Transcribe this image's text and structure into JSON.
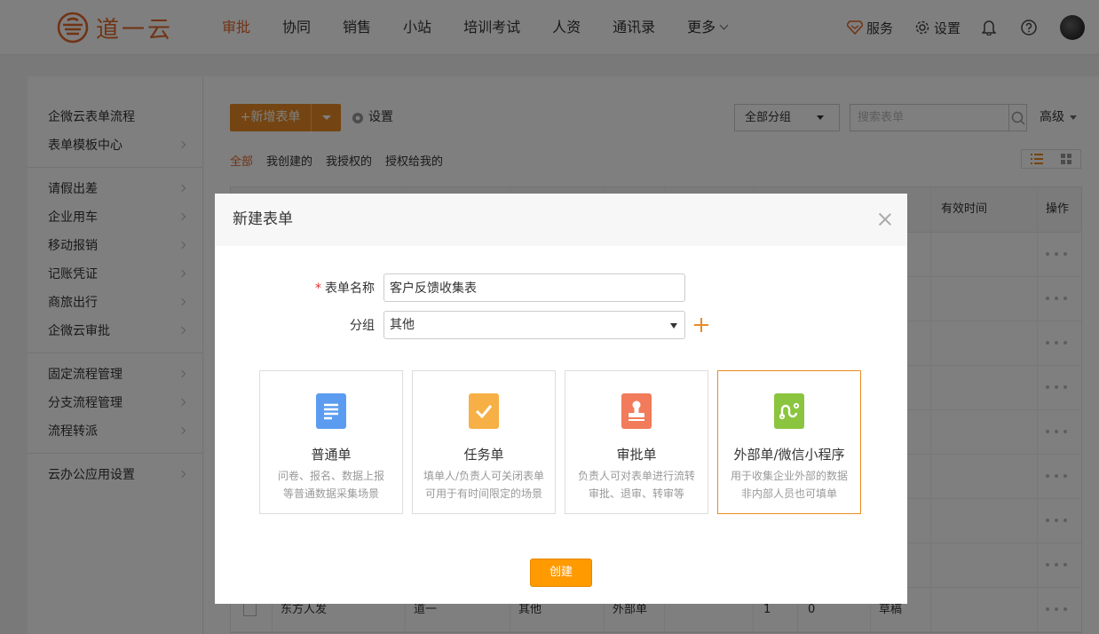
{
  "app": {
    "logo_text": "道一云",
    "brand_color": "#e0682d"
  },
  "nav": {
    "items": [
      {
        "label": "审批",
        "active": true
      },
      {
        "label": "协同"
      },
      {
        "label": "销售"
      },
      {
        "label": "小站"
      },
      {
        "label": "培训考试"
      },
      {
        "label": "人资"
      },
      {
        "label": "通讯录"
      },
      {
        "label": "更多"
      }
    ]
  },
  "tools": {
    "service": "服务",
    "settings": "设置"
  },
  "sidebar": {
    "groups": [
      [
        "企微云表单流程",
        "表单模板中心"
      ],
      [
        "请假出差",
        "企业用车",
        "移动报销",
        "记账凭证",
        "商旅出行",
        "企微云审批"
      ],
      [
        "固定流程管理",
        "分支流程管理",
        "流程转派"
      ],
      [
        "云办公应用设置"
      ]
    ]
  },
  "toolbar": {
    "add_label": "+新增表单",
    "settings_label": "设置",
    "group_select": "全部分组",
    "search_placeholder": "搜索表单",
    "advanced": "高级"
  },
  "filters": [
    "全部",
    "我创建的",
    "我授权的",
    "授权给我的"
  ],
  "table": {
    "headers": {
      "valid_time": "有效时间",
      "actions": "操作"
    },
    "last_row": {
      "name": "东方人发",
      "creator": "道一",
      "group": "其他",
      "type": "外部单",
      "n1": "1",
      "n2": "0",
      "status": "草稿"
    }
  },
  "modal": {
    "title": "新建表单",
    "name_label": "表单名称",
    "name_value": "客户反馈收集表",
    "group_label": "分组",
    "group_value": "其他",
    "create_button": "创建",
    "cards": [
      {
        "title": "普通单",
        "desc1": "问卷、报名、数据上报",
        "desc2": "等普通数据采集场景",
        "icon": "document-icon",
        "color": "#5b9cf0"
      },
      {
        "title": "任务单",
        "desc1": "填单人/负责人可关闭表单",
        "desc2": "可用于有时间限定的场景",
        "icon": "check-icon",
        "color": "#f7b045"
      },
      {
        "title": "审批单",
        "desc1": "负责人可对表单进行流转",
        "desc2": "审批、退审、转审等",
        "icon": "stamp-icon",
        "color": "#f17b5a"
      },
      {
        "title": "外部单/微信小程序",
        "desc1": "用于收集企业外部的数据",
        "desc2": "非内部人员也可填单",
        "icon": "link-icon",
        "color": "#8bc53f",
        "selected": true
      }
    ]
  }
}
